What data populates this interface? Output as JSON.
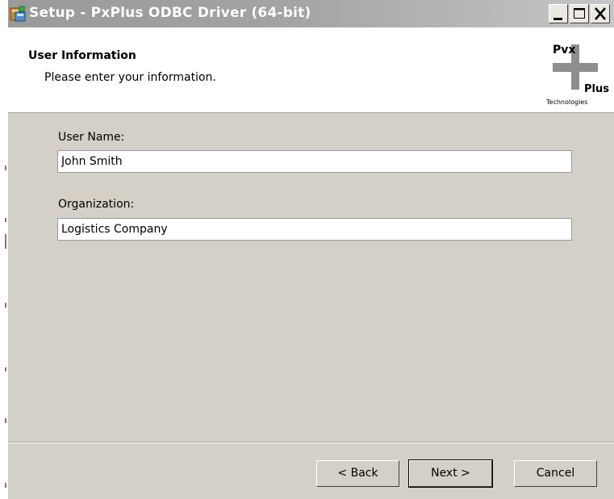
{
  "window": {
    "title": "Setup - PxPlus ODBC Driver (64-bit)",
    "controls": {
      "minimize_icon": "minimize-icon",
      "maximize_icon": "maximize-icon",
      "close_icon": "close-icon"
    }
  },
  "header": {
    "title": "User Information",
    "subtitle": "Please enter your information.",
    "logo": {
      "top_text": "Pvx",
      "right_text": "Plus",
      "bottom_text": "Technologies"
    }
  },
  "form": {
    "user_name_label": "User Name:",
    "user_name_value": "John Smith",
    "organization_label": "Organization:",
    "organization_value": "Logistics Company"
  },
  "buttons": {
    "back": "< Back",
    "next": "Next >",
    "cancel": "Cancel"
  },
  "colors": {
    "dialog_background": "#d4d0c8",
    "header_background": "#ffffff",
    "titlebar_gray": "#a3a3a3"
  }
}
